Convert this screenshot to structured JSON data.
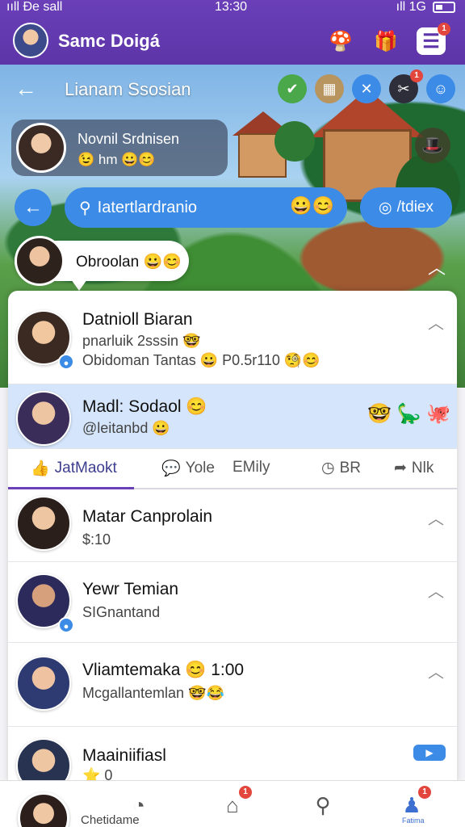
{
  "status_bar": {
    "left": "ııll Ðe sall",
    "time": "13:30",
    "right": "ıll 1G"
  },
  "app_bar": {
    "title": "Samc Doigá",
    "inbox_badge": "1"
  },
  "session": {
    "title": "Lianam Ssosian",
    "top_icon_badge": "1",
    "host_name": "Novnil Srdnisen",
    "host_sub": "😉 hm 😀😊",
    "search_text": "Iatertlardranio",
    "search_emoji": "😀😊",
    "index_label": "/tdiex",
    "bubble_text": "Obroolan 😀😊"
  },
  "list": {
    "rows": [
      {
        "name": "Datnioll Biaran",
        "line1": "pnarluik 2sssin 🤓",
        "line2": "Obidoman Tantas 😀 P0.5r110 🧐😊"
      },
      {
        "name": "Madl: Sodaol 😊",
        "line1": "@leitanbd 😀",
        "emojis": "🤓 🦕 🐙"
      },
      {
        "name": "Matar Canprolain",
        "line1": "$:10"
      },
      {
        "name": "Yewr Temian",
        "line1": "SIGnantand"
      },
      {
        "name": "Vliamtemaka 😊 1:00",
        "line1": "Mcgallantemlan 🤓😂"
      },
      {
        "name": "Maainiifiasl",
        "line1": "⭐ 0"
      }
    ],
    "tabs": [
      {
        "label": "JatMaokt"
      },
      {
        "label": "Yole"
      },
      {
        "label": "EMily"
      },
      {
        "label": "BR"
      },
      {
        "label": "Nlk"
      }
    ]
  },
  "bottom_nav": {
    "label": "Chetidame",
    "label_small": "Fatima",
    "badge1": "1",
    "badge2": "1"
  }
}
